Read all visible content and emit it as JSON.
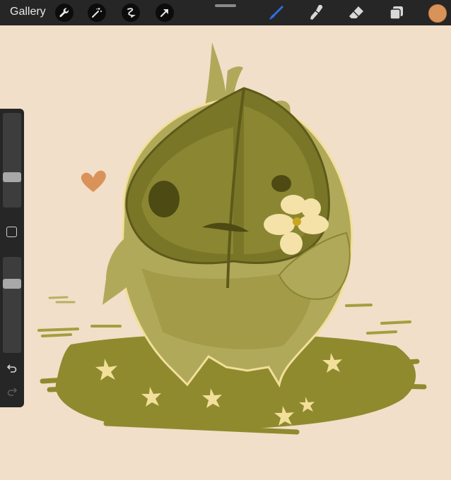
{
  "toolbar": {
    "gallery_label": "Gallery",
    "left_tools": [
      "wrench-icon",
      "magic-wand-icon",
      "selection-icon",
      "transform-arrow-icon"
    ],
    "right_tools": [
      "brush-icon",
      "smudge-icon",
      "eraser-icon",
      "layers-icon"
    ],
    "active_tool": "brush-icon",
    "active_color": "#d9935a"
  },
  "sidebar": {
    "brush_size_level": 0.3,
    "opacity_level": 0.75
  },
  "colors": {
    "canvas_bg": "#f2dfc9",
    "accent_brush": "#2f6fe0"
  }
}
